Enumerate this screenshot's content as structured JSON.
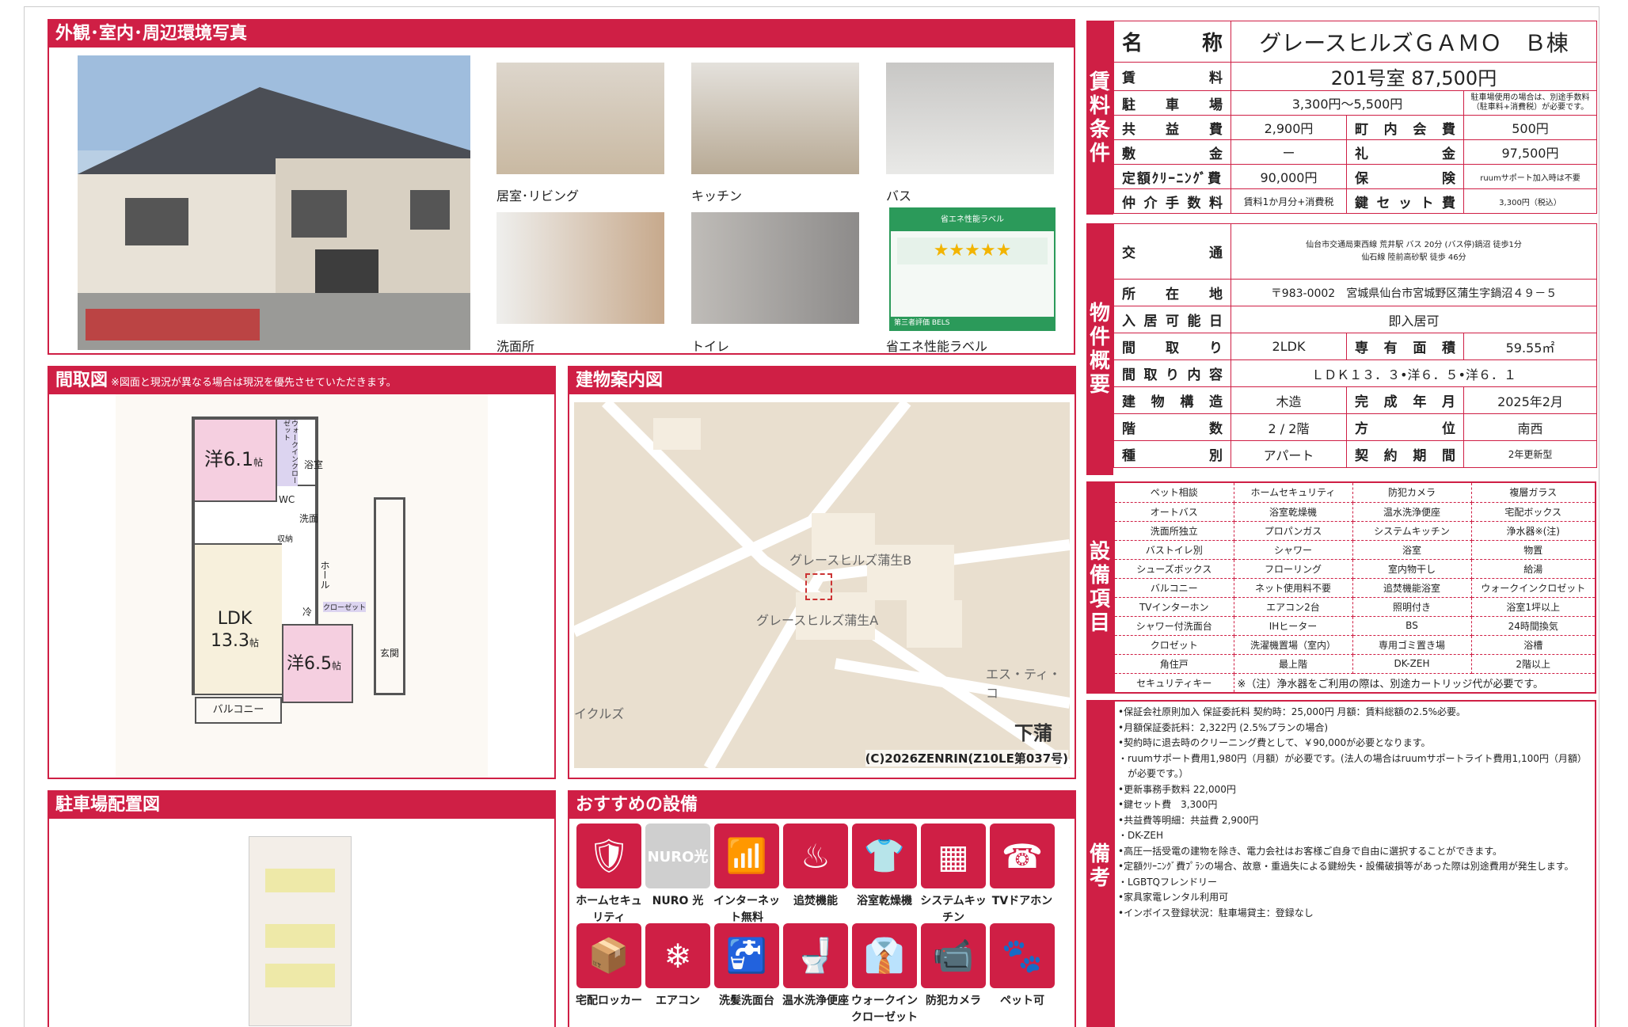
{
  "sections": {
    "photos": "外観･室内･周辺環境写真",
    "floorplan": "間取図",
    "floorplan_note": "※図面と現況が異なる場合は現況を優先させていただきます。",
    "map": "建物案内図",
    "parking": "駐車場配置図",
    "recommended": "おすすめの設備"
  },
  "photos": [
    {
      "label": "居室･リビング"
    },
    {
      "label": "キッチン"
    },
    {
      "label": "バス"
    },
    {
      "label": "洗面所"
    },
    {
      "label": "トイレ"
    },
    {
      "label": "省エネ性能ラベル"
    }
  ],
  "energy_label": {
    "title": "省エネ性能ラベル",
    "bels": "第三者評価 BELS"
  },
  "floorplan": {
    "r1": "洋6.1",
    "r1u": "帖",
    "ldk": "LDK",
    "ldk_size": "13.3",
    "ldk_u": "帖",
    "r2": "洋6.5",
    "r2u": "帖",
    "bath": "浴室",
    "wc": "WC",
    "wash": "洗面",
    "wash2": "洗",
    "storage": "収納",
    "walkin": "ウォークインクローゼット",
    "hall": "ホール",
    "fridge": "冷",
    "closet": "クローゼット",
    "entrance": "玄関",
    "balcony": "バルコニー"
  },
  "map": {
    "b": "グレースヒルズ蒲生B",
    "a": "グレースヒルズ蒲生A",
    "st": "エス・ティ・コ",
    "left": "イクルズ",
    "town": "下蒲",
    "copyright": "(C)2026ZENRIN(Z10LE第037号)"
  },
  "vertical": {
    "rent": "賃料条件",
    "property": "物件概要",
    "equipment": "設備項目",
    "notes": "備考"
  },
  "rent": {
    "name_label": "名　称",
    "name": "グレースヒルズＧＡＭＯ　Ｂ棟",
    "rent_label": "賃　料",
    "rent": "201号室 87,500円",
    "parking_label": "駐車場",
    "parking": "3,300円～5,500円",
    "parking_note": "駐車場使用の場合は、別途手数料（駐車料+消費税）が必要です。",
    "common_label": "共益費",
    "common": "2,900円",
    "town_label": "町内会費",
    "town": "500円",
    "deposit_label": "敷金",
    "deposit": "ー",
    "key_money_label": "礼金",
    "key_money": "97,500円",
    "cleaning_label": "定額ｸﾘｰﾆﾝｸﾞ費",
    "cleaning": "90,000円",
    "insurance_label": "保険",
    "insurance": "ruumサポート加入時は不要",
    "broker_label": "仲介手数料",
    "broker": "賃料1か月分+消費税",
    "keyset_label": "鍵セット費",
    "keyset": "3,300円（税込）"
  },
  "property": {
    "transport_label": "交　通",
    "transport1": "仙台市交通局東西線 荒井駅 バス 20分 (バス停)鍋沼 徒歩1分",
    "transport2": "仙石線 陸前高砂駅 徒歩 46分",
    "address_label": "所在地",
    "address": "〒983-0002　宮城県仙台市宮城野区蒲生字鍋沼４９－５",
    "move_label": "入居可能日",
    "move": "即入居可",
    "layout_label": "間取り",
    "layout": "2LDK",
    "area_label": "専有面積",
    "area": "59.55㎡",
    "detail_label": "間取り内容",
    "detail": "ＬＤＫ１３．３•洋６．５•洋６．１",
    "structure_label": "建物構造",
    "structure": "木造",
    "built_label": "完成年月",
    "built": "2025年2月",
    "floor_label": "階数",
    "floor": "2 / 2階",
    "dir_label": "方位",
    "dir": "南西",
    "type_label": "種別",
    "type": "アパート",
    "contract_label": "契約期間",
    "contract": "2年更新型"
  },
  "equipment": [
    [
      "ペット相談",
      "ホームセキュリティ",
      "防犯カメラ",
      "複層ガラス"
    ],
    [
      "オートバス",
      "浴室乾燥機",
      "温水洗浄便座",
      "宅配ボックス"
    ],
    [
      "洗面所独立",
      "プロパンガス",
      "システムキッチン",
      "浄水器※(注)"
    ],
    [
      "バストイレ別",
      "シャワー",
      "浴室",
      "物置"
    ],
    [
      "シューズボックス",
      "フローリング",
      "室内物干し",
      "給湯"
    ],
    [
      "バルコニー",
      "ネット使用料不要",
      "追焚機能浴室",
      "ウォークインクロゼット"
    ],
    [
      "TVインターホン",
      "エアコン2台",
      "照明付き",
      "浴室1坪以上"
    ],
    [
      "シャワー付洗面台",
      "IHヒーター",
      "BS",
      "24時間換気"
    ],
    [
      "クロゼット",
      "洗濯機置場（室内）",
      "専用ゴミ置き場",
      "浴槽"
    ],
    [
      "角住戸",
      "最上階",
      "DK-ZEH",
      "2階以上"
    ]
  ],
  "equipment_last": {
    "a": "セキュリティキー",
    "b": "※（注）浄水器をご利用の際は、別途カートリッジ代が必要です。"
  },
  "notes": [
    "•保証会社原則加入 保証委託料 契約時：25,000円 月額：賃料総額の2.5%必要。",
    "•月額保証委託料：2,322円 (2.5%プランの場合)",
    "•契約時に退去時のクリーニング費として、￥90,000が必要となります。",
    "・ruumサポート費用1,980円（月額）が必要です。(法人の場合はruumサポートライト費用1,100円（月額）",
    "　が必要です。）",
    "•更新事務手数料 22,000円",
    "•鍵セット費　3,300円",
    "•共益費等明細：共益費 2,900円",
    "・DK-ZEH",
    "•高圧一括受電の建物を除き、電力会社はお客様ご自身で自由に選択することができます。",
    "•定額ｸﾘｰﾆﾝｸﾞ費ﾌﾟﾗﾝの場合、故意・重過失による鍵紛失・設備破損等があった際は別途費用が発生します。",
    "・LGBTQフレンドリー",
    "•家具家電レンタル利用可",
    "•インボイス登録状況：駐車場貸主：登録なし"
  ],
  "features": [
    {
      "label": "ホームセキュリティ",
      "icon": "shield-icon"
    },
    {
      "label": "NURO 光",
      "icon": "nuro-icon",
      "text": "NURO光"
    },
    {
      "label": "インターネット無料",
      "icon": "wifi-icon"
    },
    {
      "label": "追焚機能",
      "icon": "bathtub-icon"
    },
    {
      "label": "浴室乾燥機",
      "icon": "bath-dryer-icon"
    },
    {
      "label": "システムキッチン",
      "icon": "kitchen-icon"
    },
    {
      "label": "TVドアホン",
      "icon": "intercom-icon"
    },
    {
      "label": "宅配ロッカー",
      "icon": "locker-icon"
    },
    {
      "label": "エアコン",
      "icon": "aircon-icon"
    },
    {
      "label": "洗髪洗面台",
      "icon": "sink-icon"
    },
    {
      "label": "温水洗浄便座",
      "icon": "toilet-icon"
    },
    {
      "label": "ウォークインクローゼット",
      "icon": "closet-icon"
    },
    {
      "label": "防犯カメラ",
      "icon": "camera-icon"
    },
    {
      "label": "ペット可",
      "icon": "paw-icon"
    }
  ]
}
